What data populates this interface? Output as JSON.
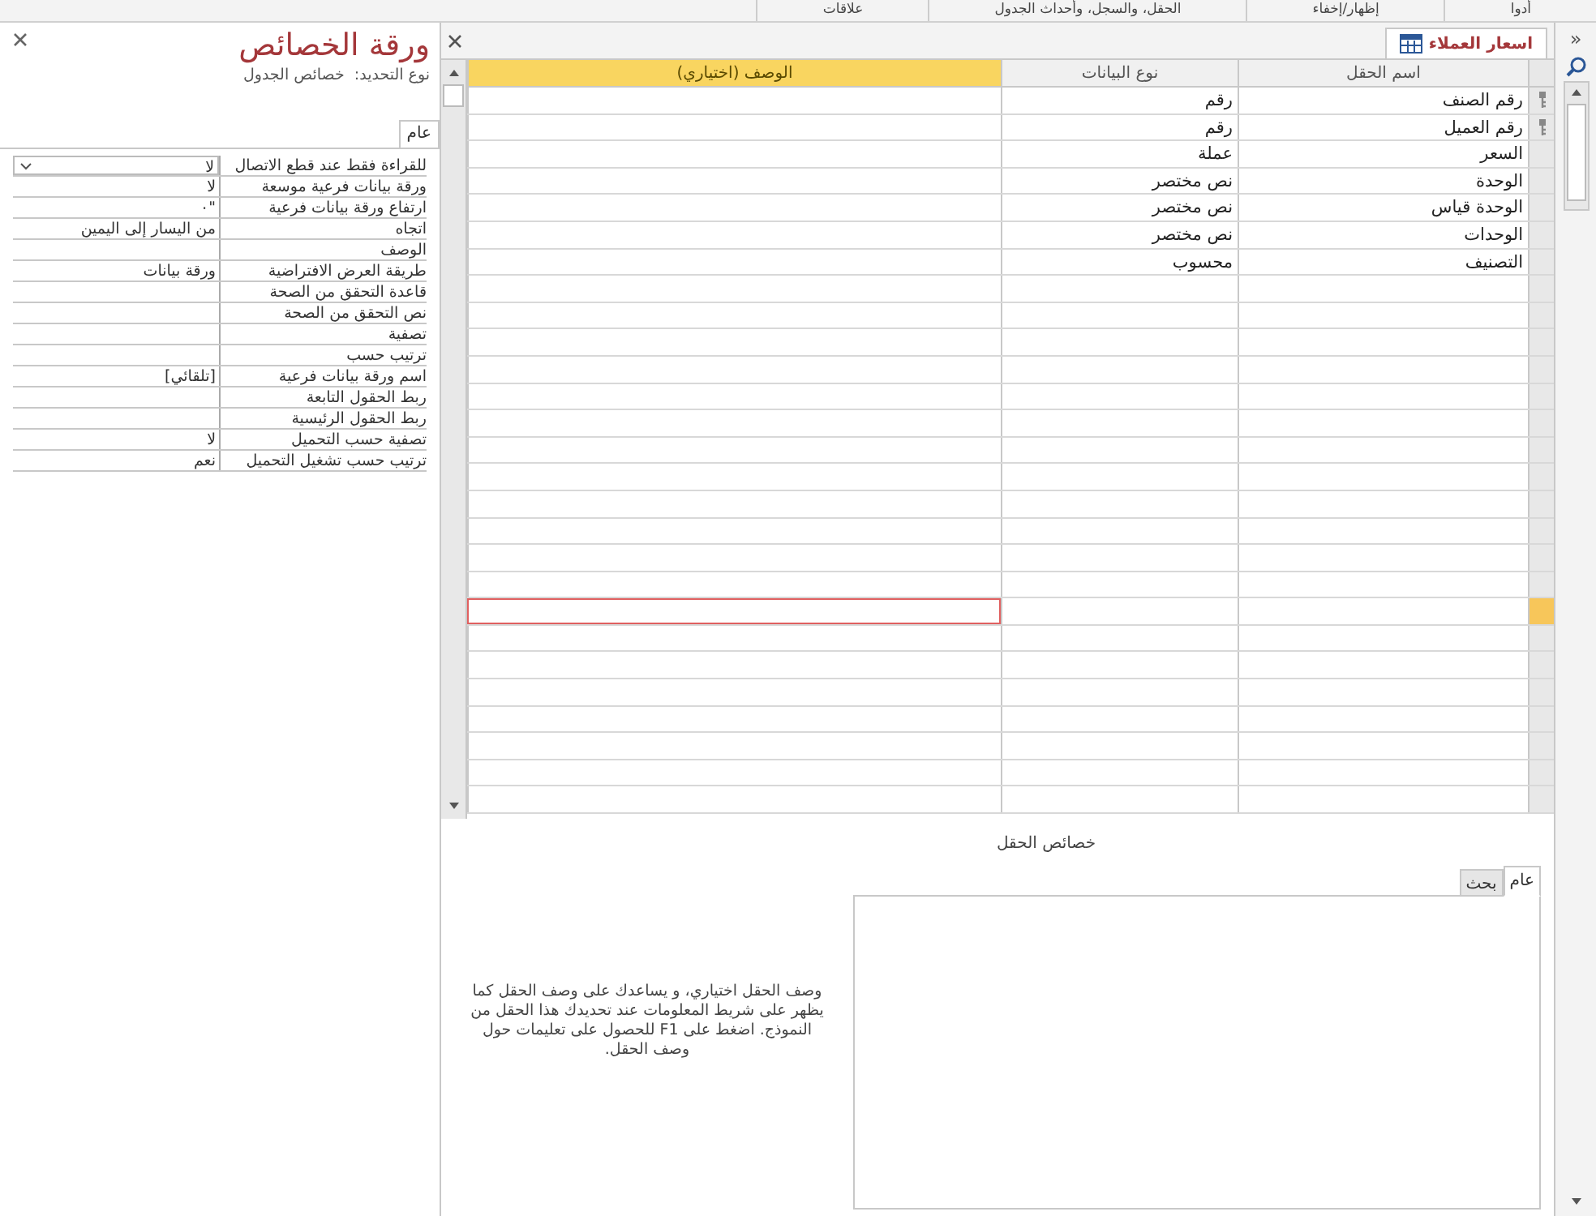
{
  "ribbon_groups": [
    "أدوا",
    "إظهار/إخفاء",
    "الحقل، والسجل، وأحداث الجدول",
    "علاقات"
  ],
  "document_tab": {
    "title": "اسعار العملاء",
    "selected": true
  },
  "columns": [
    "اسم الحقل",
    "نوع البيانات",
    "الوصف (اختياري)"
  ],
  "rows": [
    {
      "field_name": "رقم الصنف",
      "data_type": "رقم",
      "primary_key": true,
      "current": false
    },
    {
      "field_name": "رقم العميل",
      "data_type": "رقم",
      "primary_key": true,
      "current": false
    },
    {
      "field_name": "السعر",
      "data_type": "عملة",
      "primary_key": false,
      "current": false
    },
    {
      "field_name": "الوحدة",
      "data_type": "نص مختصر",
      "primary_key": false,
      "current": false
    },
    {
      "field_name": "الوحدة قياس",
      "data_type": "نص مختصر",
      "primary_key": false,
      "current": false
    },
    {
      "field_name": "الوحدات",
      "data_type": "نص مختصر",
      "primary_key": false,
      "current": false
    },
    {
      "field_name": "التصنيف",
      "data_type": "محسوب",
      "primary_key": false,
      "current": false
    },
    {
      "primary_key": false,
      "current": false
    },
    {
      "primary_key": false,
      "current": false
    },
    {
      "primary_key": false,
      "current": false
    },
    {
      "primary_key": false,
      "current": false
    },
    {
      "primary_key": false,
      "current": false
    },
    {
      "primary_key": false,
      "current": false
    },
    {
      "primary_key": false,
      "current": false
    },
    {
      "primary_key": false,
      "current": false
    },
    {
      "primary_key": false,
      "current": false
    },
    {
      "primary_key": false,
      "current": false
    },
    {
      "primary_key": false,
      "current": false
    },
    {
      "primary_key": false,
      "current": false
    },
    {
      "primary_key": false,
      "current": true
    },
    {
      "primary_key": false,
      "current": false
    },
    {
      "primary_key": false,
      "current": false
    },
    {
      "primary_key": false,
      "current": false
    },
    {
      "primary_key": false,
      "current": false
    },
    {
      "primary_key": false,
      "current": false
    },
    {
      "primary_key": false,
      "current": false
    },
    {
      "primary_key": false,
      "current": false
    }
  ],
  "field_properties": {
    "label": "خصائص الحقل",
    "tabs": [
      {
        "label": "عام",
        "selected": true
      },
      {
        "label": "بحث",
        "selected": false
      }
    ],
    "help_text": "وصف الحقل اختياري، و يساعدك على وصف الحقل كما يظهر على شريط المعلومات عند تحديدك هذا الحقل من النموذج. اضغط على F1 للحصول على تعليمات حول وصف الحقل."
  },
  "property_sheet": {
    "title": "ورقة الخصائص",
    "selection_type_label": "نوع التحديد:",
    "selection_type": "خصائص الجدول",
    "tabs": [
      {
        "label": "عام",
        "selected": true
      }
    ],
    "properties": [
      {
        "name": "للقراءة فقط عند قطع الاتصال",
        "value": "لا",
        "kind": "dropdown"
      },
      {
        "name": "ورقة بيانات فرعية موسعة",
        "value": "لا",
        "kind": "text"
      },
      {
        "name": "ارتفاع ورقة بيانات فرعية",
        "value": "\"٠",
        "kind": "text"
      },
      {
        "name": "اتجاه",
        "value": "من اليسار إلى اليمين",
        "kind": "text"
      },
      {
        "name": "الوصف",
        "kind": "text"
      },
      {
        "name": "طريقة العرض الافتراضية",
        "value": "ورقة بيانات",
        "kind": "text"
      },
      {
        "name": "قاعدة التحقق من الصحة",
        "kind": "text"
      },
      {
        "name": "نص التحقق من الصحة",
        "kind": "text"
      },
      {
        "name": "تصفية",
        "kind": "text"
      },
      {
        "name": "ترتيب حسب",
        "kind": "text"
      },
      {
        "name": "اسم ورقة بيانات فرعية",
        "value": "[تلقائي]",
        "kind": "text"
      },
      {
        "name": "ربط الحقول التابعة",
        "kind": "text"
      },
      {
        "name": "ربط الحقول الرئيسية",
        "kind": "text"
      },
      {
        "name": "تصفية حسب التحميل",
        "value": "لا",
        "kind": "text"
      },
      {
        "name": "ترتيب حسب تشغيل التحميل",
        "value": "نعم",
        "kind": "text"
      }
    ]
  },
  "navigation_pane": {
    "toggle": "»"
  }
}
